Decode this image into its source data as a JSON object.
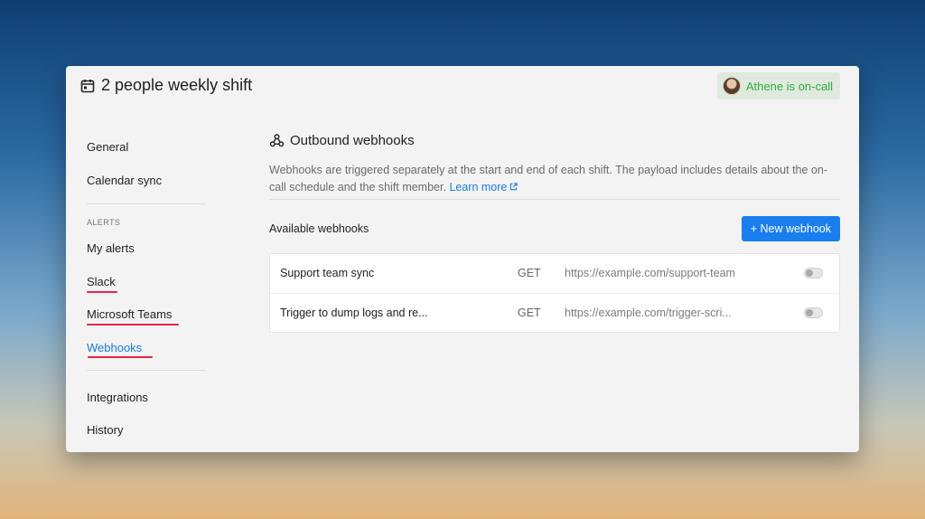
{
  "header": {
    "title": "2 people weekly shift",
    "oncall_text": "Athene is on-call"
  },
  "sidebar": {
    "items_top": [
      {
        "label": "General"
      },
      {
        "label": "Calendar sync"
      }
    ],
    "section_label": "ALERTS",
    "alert_items": [
      {
        "label": "My alerts"
      },
      {
        "label": "Slack"
      },
      {
        "label": "Microsoft Teams"
      },
      {
        "label": "Webhooks",
        "active": true
      }
    ],
    "items_bottom": [
      {
        "label": "Integrations"
      },
      {
        "label": "History"
      }
    ]
  },
  "main": {
    "heading": "Outbound webhooks",
    "description": "Webhooks are triggered separately at the start and end of each shift. The payload includes details about the on-call schedule and the shift member.",
    "learn_more": "Learn more",
    "available_label": "Available webhooks",
    "new_button": "+ New webhook",
    "webhooks": [
      {
        "name": "Support team sync",
        "method": "GET",
        "url": "https://example.com/support-team",
        "enabled": false
      },
      {
        "name": "Trigger to dump logs and re...",
        "method": "GET",
        "url": "https://example.com/trigger-scri...",
        "enabled": false
      }
    ]
  },
  "colors": {
    "accent": "#1a7fee",
    "oncall": "#2fae3e",
    "annotation_underline": "#e0284a"
  },
  "icons": [
    "calendar-icon",
    "webhook-icon",
    "external-link-icon",
    "avatar"
  ]
}
